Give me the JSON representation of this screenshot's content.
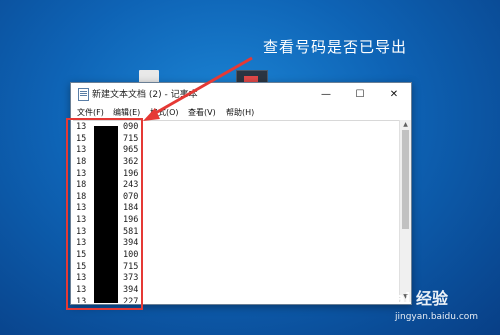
{
  "annotation": {
    "text": "查看号码是否已导出",
    "color": "#ffffff",
    "highlight_color": "#e53935"
  },
  "window": {
    "title": "新建文本文档 (2) - 记事本",
    "controls": {
      "minimize": "—",
      "maximize": "☐",
      "close": "✕"
    },
    "icon": "notepad-icon"
  },
  "menu": [
    {
      "label": "文件(F)"
    },
    {
      "label": "编辑(E)"
    },
    {
      "label": "格式(O)"
    },
    {
      "label": "查看(V)"
    },
    {
      "label": "帮助(H)"
    }
  ],
  "editor": {
    "lines": [
      {
        "lead": "13",
        "tail": "090"
      },
      {
        "lead": "15",
        "tail": "715"
      },
      {
        "lead": "13",
        "tail": "965"
      },
      {
        "lead": "18",
        "tail": "362"
      },
      {
        "lead": "13",
        "tail": "196"
      },
      {
        "lead": "18",
        "tail": "243"
      },
      {
        "lead": "18",
        "tail": "070"
      },
      {
        "lead": "13",
        "tail": "184"
      },
      {
        "lead": "13",
        "tail": "196"
      },
      {
        "lead": "13",
        "tail": "581"
      },
      {
        "lead": "13",
        "tail": "394"
      },
      {
        "lead": "15",
        "tail": "100"
      },
      {
        "lead": "15",
        "tail": "715"
      },
      {
        "lead": "13",
        "tail": "373"
      },
      {
        "lead": "13",
        "tail": "394"
      },
      {
        "lead": "13",
        "tail": "227"
      }
    ],
    "redaction_color": "#000000"
  },
  "scrollbar": {
    "up_icon": "▲",
    "down_icon": "▼"
  },
  "watermark": {
    "brand": "Bai 经验",
    "url": "jingyan.baidu.com"
  }
}
